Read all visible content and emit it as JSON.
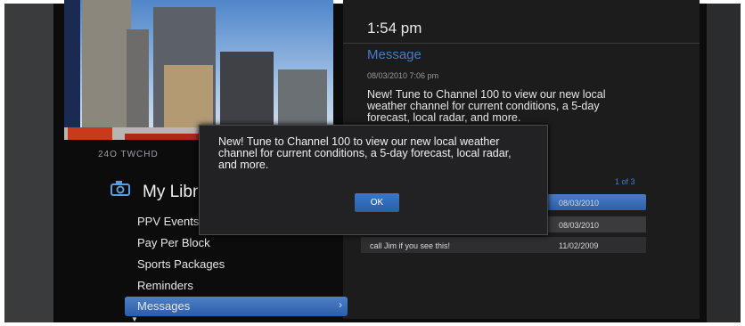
{
  "clock": "1:54 pm",
  "message": {
    "title": "Message",
    "date": "08/03/2010 7:06 pm",
    "body": "New! Tune to Channel 100 to view our new local weather channel for current conditions, a 5-day forecast, local radar, and more."
  },
  "video_caption": "24O TWCHD",
  "library": {
    "title": "My Library",
    "items": [
      "PPV Events",
      "Pay Per Block",
      "Sports Packages",
      "Reminders",
      "Messages"
    ],
    "selected": "Messages"
  },
  "message_list": {
    "page": "1 of 3",
    "rows": [
      {
        "subject": "",
        "date": "08/03/2010"
      },
      {
        "subject": "",
        "date": "08/03/2010"
      },
      {
        "subject": "call Jim if you see this!",
        "date": "11/02/2009"
      }
    ]
  },
  "dialog": {
    "text": "New! Tune to Channel 100 to view our new local weather channel for current conditions, a 5-day forecast, local radar, and more.",
    "ok_label": "OK"
  },
  "colors": {
    "accent": "#3f7fcf",
    "selection": "#2a5ea9",
    "background": "#0c0c0d"
  }
}
